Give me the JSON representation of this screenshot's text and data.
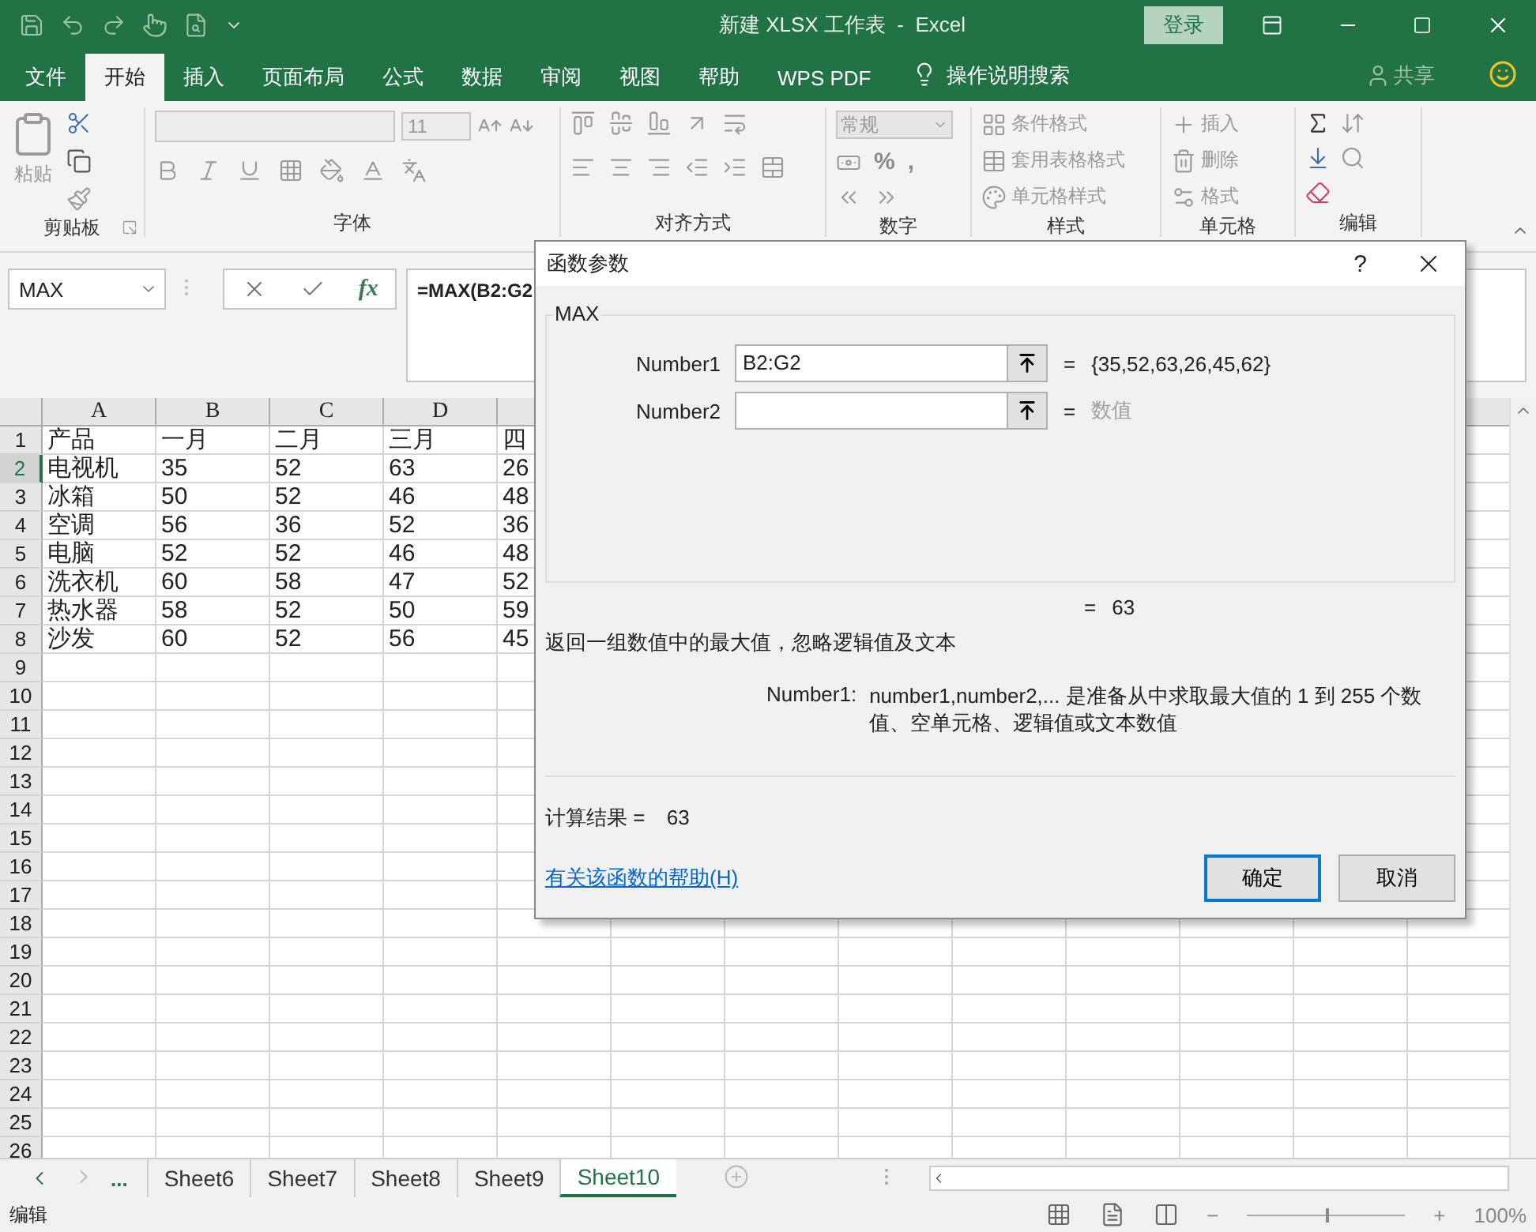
{
  "title_bar": {
    "title": "新建 XLSX 工作表  -  Excel",
    "sign_in": "登录"
  },
  "ribbon_tabs": [
    {
      "label": "文件",
      "selected": false
    },
    {
      "label": "开始",
      "selected": true
    },
    {
      "label": "插入",
      "selected": false
    },
    {
      "label": "页面布局",
      "selected": false
    },
    {
      "label": "公式",
      "selected": false
    },
    {
      "label": "数据",
      "selected": false
    },
    {
      "label": "审阅",
      "selected": false
    },
    {
      "label": "视图",
      "selected": false
    },
    {
      "label": "帮助",
      "selected": false
    },
    {
      "label": "WPS PDF",
      "selected": false
    }
  ],
  "tell_me": "操作说明搜索",
  "share": "共享",
  "ribbon": {
    "clipboard": {
      "paste": "粘贴",
      "label": "剪贴板"
    },
    "font": {
      "size": "11",
      "label": "字体"
    },
    "alignment": {
      "label": "对齐方式"
    },
    "number": {
      "format": "常规",
      "symbols": [
        "%",
        ","
      ],
      "label": "数字"
    },
    "styles": {
      "items": [
        "条件格式",
        "套用表格格式",
        "单元格样式"
      ],
      "label": "样式"
    },
    "cells": {
      "items": [
        "插入",
        "删除",
        "格式"
      ],
      "label": "单元格"
    },
    "editing": {
      "label": "编辑"
    }
  },
  "formula_bar": {
    "name_box": "MAX",
    "fx": "fx",
    "formula": "=MAX(B2:G2"
  },
  "sheet": {
    "columns": [
      "A",
      "B",
      "C",
      "D"
    ],
    "rows": [
      {
        "header": "1",
        "selected": false,
        "cells": [
          "产品",
          "一月",
          "二月",
          "三月",
          "四"
        ]
      },
      {
        "header": "2",
        "selected": true,
        "cells": [
          "电视机",
          "35",
          "52",
          "63",
          "26"
        ]
      },
      {
        "header": "3",
        "selected": false,
        "cells": [
          "冰箱",
          "50",
          "52",
          "46",
          "48"
        ]
      },
      {
        "header": "4",
        "selected": false,
        "cells": [
          "空调",
          "56",
          "36",
          "52",
          "36"
        ]
      },
      {
        "header": "5",
        "selected": false,
        "cells": [
          "电脑",
          "52",
          "52",
          "46",
          "48"
        ]
      },
      {
        "header": "6",
        "selected": false,
        "cells": [
          "洗衣机",
          "60",
          "58",
          "47",
          "52"
        ]
      },
      {
        "header": "7",
        "selected": false,
        "cells": [
          "热水器",
          "58",
          "52",
          "50",
          "59"
        ]
      },
      {
        "header": "8",
        "selected": false,
        "cells": [
          "沙发",
          "60",
          "52",
          "56",
          "45"
        ]
      },
      {
        "header": "9",
        "selected": false
      },
      {
        "header": "10",
        "selected": false
      },
      {
        "header": "11",
        "selected": false
      },
      {
        "header": "12",
        "selected": false
      },
      {
        "header": "13",
        "selected": false
      },
      {
        "header": "14",
        "selected": false
      },
      {
        "header": "15",
        "selected": false
      },
      {
        "header": "16",
        "selected": false
      },
      {
        "header": "17",
        "selected": false
      },
      {
        "header": "18",
        "selected": false
      },
      {
        "header": "19",
        "selected": false
      },
      {
        "header": "20",
        "selected": false
      },
      {
        "header": "21",
        "selected": false
      },
      {
        "header": "22",
        "selected": false
      },
      {
        "header": "23",
        "selected": false
      },
      {
        "header": "24",
        "selected": false
      },
      {
        "header": "25",
        "selected": false
      },
      {
        "header": "26",
        "selected": false
      }
    ]
  },
  "sheet_tabs": {
    "more": "...",
    "tabs": [
      {
        "label": "Sheet6",
        "selected": false
      },
      {
        "label": "Sheet7",
        "selected": false
      },
      {
        "label": "Sheet8",
        "selected": false
      },
      {
        "label": "Sheet9",
        "selected": false
      },
      {
        "label": "Sheet10",
        "selected": true
      }
    ]
  },
  "status_bar": {
    "mode": "编辑",
    "zoom_out": "−",
    "zoom_in": "+",
    "zoom": "100%",
    "zoom_slider": {
      "level": 0.5
    }
  },
  "dialog": {
    "title": "函数参数",
    "help": "?",
    "function": "MAX",
    "args": [
      {
        "label": "Number1",
        "value": "B2:G2",
        "equals": "=",
        "result": "{35,52,63,26,45,62}",
        "greyed": false
      },
      {
        "label": "Number2",
        "equals": "=",
        "result": "数值",
        "greyed": true
      }
    ],
    "formula_result": {
      "equals": "=",
      "value": "63"
    },
    "description": "返回一组数值中的最大值，忽略逻辑值及文本",
    "arg_help": {
      "label": "Number1:",
      "text": "number1,number2,... 是准备从中求取最大值的 1 到 255 个数值、空单元格、逻辑值或文本数值"
    },
    "result": {
      "label": "计算结果 =",
      "value": "63"
    },
    "help_link": "有关该函数的帮助(H)",
    "buttons": [
      {
        "label": "确定",
        "default": true
      },
      {
        "label": "取消",
        "default": false
      }
    ]
  }
}
